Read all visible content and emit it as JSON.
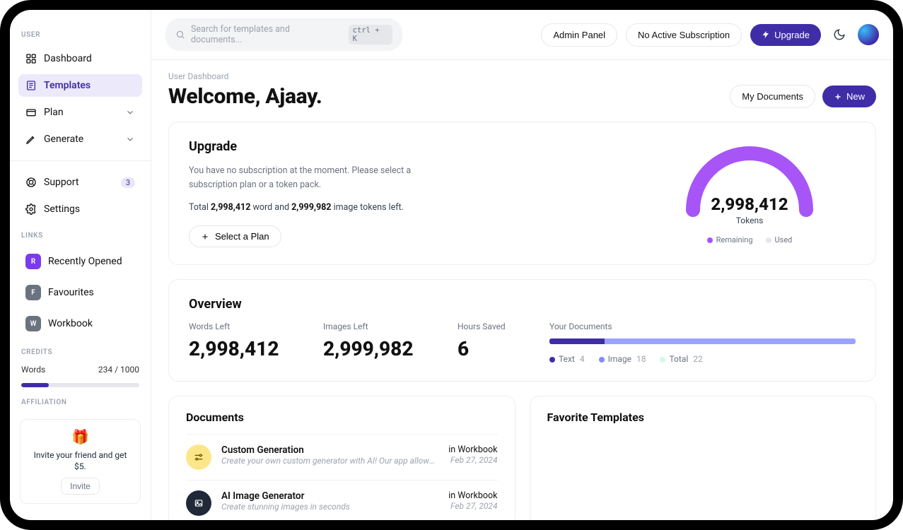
{
  "colors": {
    "primary": "#3f2da8",
    "accent": "#a855f7",
    "muted": "#9ca3af",
    "usedDot": "#e5e7eb"
  },
  "topbar": {
    "search_placeholder": "Search for templates and documents...",
    "search_hotkey": "ctrl + K",
    "admin_label": "Admin Panel",
    "subscription_label": "No Active Subscription",
    "upgrade_label": "Upgrade"
  },
  "sidebar": {
    "section_user": "USER",
    "items": [
      {
        "label": "Dashboard"
      },
      {
        "label": "Templates"
      },
      {
        "label": "Plan"
      },
      {
        "label": "Generate"
      }
    ],
    "support_label": "Support",
    "support_badge": "3",
    "settings_label": "Settings",
    "section_links": "LINKS",
    "links": [
      {
        "letter": "R",
        "label": "Recently Opened"
      },
      {
        "letter": "F",
        "label": "Favourites"
      },
      {
        "letter": "W",
        "label": "Workbook"
      }
    ],
    "section_credits": "CREDITS",
    "credits_label": "Words",
    "credits_value": "234 / 1000",
    "credits_pct": 23.4,
    "section_affiliation": "AFFILIATION",
    "aff_text": "Invite your friend and get $5.",
    "aff_button": "Invite"
  },
  "header": {
    "breadcrumb": "User Dashboard",
    "welcome": "Welcome, Ajaay.",
    "my_docs_label": "My Documents",
    "new_label": "New"
  },
  "upgrade": {
    "title": "Upgrade",
    "text": "You have no subscription at the moment. Please select a subscription plan or a token pack.",
    "total_prefix": "Total ",
    "word_tokens": "2,998,412",
    "total_mid": " word and ",
    "image_tokens": "2,999,982",
    "total_suffix": " image tokens left.",
    "select_plan_label": "Select a Plan",
    "gauge_number": "2,998,412",
    "gauge_label": "Tokens",
    "legend_remaining": "Remaining",
    "legend_used": "Used"
  },
  "overview": {
    "title": "Overview",
    "stats": [
      {
        "label": "Words Left",
        "value": "2,998,412"
      },
      {
        "label": "Images Left",
        "value": "2,999,982"
      },
      {
        "label": "Hours Saved",
        "value": "6"
      }
    ],
    "docs_label": "Your Documents",
    "doc_legend": [
      {
        "label": "Text",
        "value": "4",
        "color": "#3f2da8"
      },
      {
        "label": "Image",
        "value": "18",
        "color": "#818cf8"
      },
      {
        "label": "Total",
        "value": "22",
        "color": "#d1fae5"
      }
    ],
    "doc_fill_pct": 18
  },
  "documents": {
    "title": "Documents",
    "items": [
      {
        "title": "Custom Generation",
        "desc": "Create your own custom generator with AI! Our app allows ...",
        "location": "in Workbook",
        "date": "Feb 27, 2024",
        "icon": "sliders"
      },
      {
        "title": "AI Image Generator",
        "desc": "Create stunning images in seconds",
        "location": "in Workbook",
        "date": "Feb 27, 2024",
        "icon": "image"
      }
    ]
  },
  "favorites": {
    "title": "Favorite Templates"
  },
  "chart_data": {
    "type": "pie",
    "title": "Tokens",
    "series": [
      {
        "name": "Remaining",
        "value": 2998412,
        "color": "#a855f7"
      },
      {
        "name": "Used",
        "value": 0,
        "color": "#e5e7eb"
      }
    ]
  }
}
